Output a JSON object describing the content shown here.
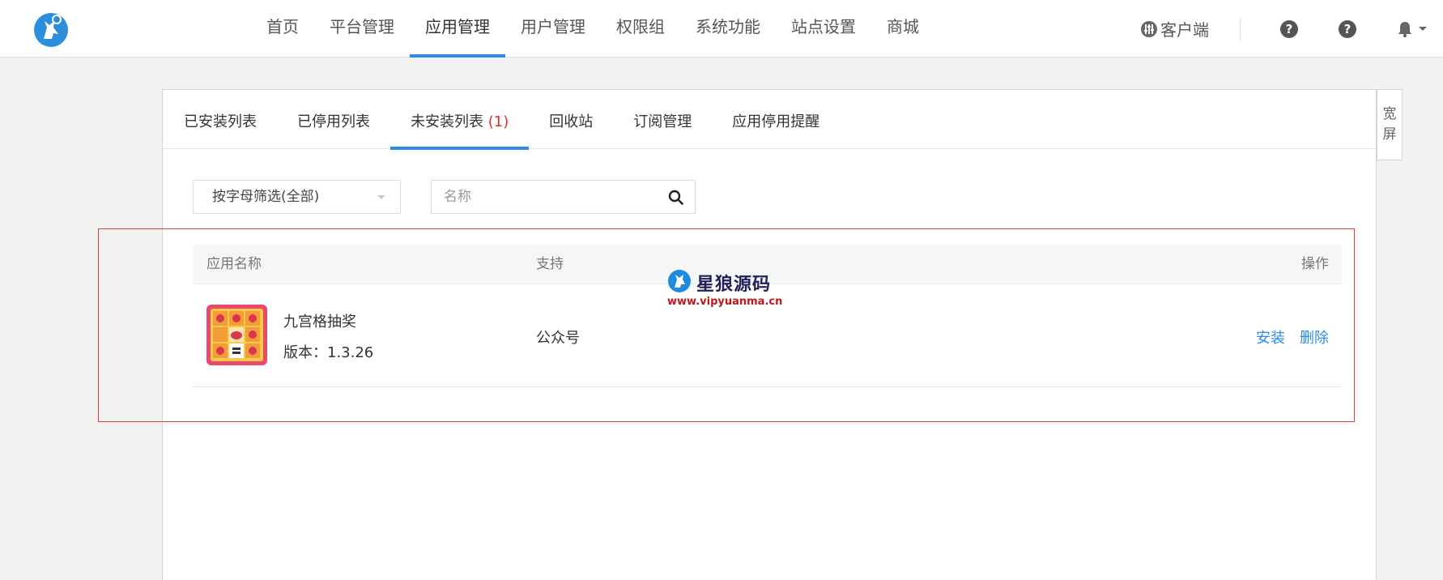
{
  "nav": {
    "items": [
      {
        "label": "首页"
      },
      {
        "label": "平台管理"
      },
      {
        "label": "应用管理"
      },
      {
        "label": "用户管理"
      },
      {
        "label": "权限组"
      },
      {
        "label": "系统功能"
      },
      {
        "label": "站点设置"
      },
      {
        "label": "商城"
      }
    ],
    "active_index": 2,
    "client_label": "客户端"
  },
  "tabs": {
    "items": [
      {
        "label": "已安装列表"
      },
      {
        "label": "已停用列表"
      },
      {
        "label": "未安装列表 ",
        "count": "(1)"
      },
      {
        "label": "回收站"
      },
      {
        "label": "订阅管理"
      },
      {
        "label": "应用停用提醒"
      }
    ],
    "active_index": 2
  },
  "side_button": {
    "line1": "宽",
    "line2": "屏"
  },
  "filter": {
    "selected": "按字母筛选(全部)"
  },
  "search": {
    "placeholder": "名称"
  },
  "table": {
    "headers": {
      "name": "应用名称",
      "support": "支持",
      "ops": "操作"
    },
    "rows": [
      {
        "name": "九宫格抽奖",
        "version": "版本：1.3.26",
        "support": "公众号",
        "install": "安装",
        "delete": "删除"
      }
    ]
  },
  "watermark": {
    "title": "星狼源码",
    "url": "www.vipyuanma.cn"
  },
  "colors": {
    "accent": "#2b8be6",
    "highlight": "#e23b3b",
    "count": "#d9312e"
  }
}
